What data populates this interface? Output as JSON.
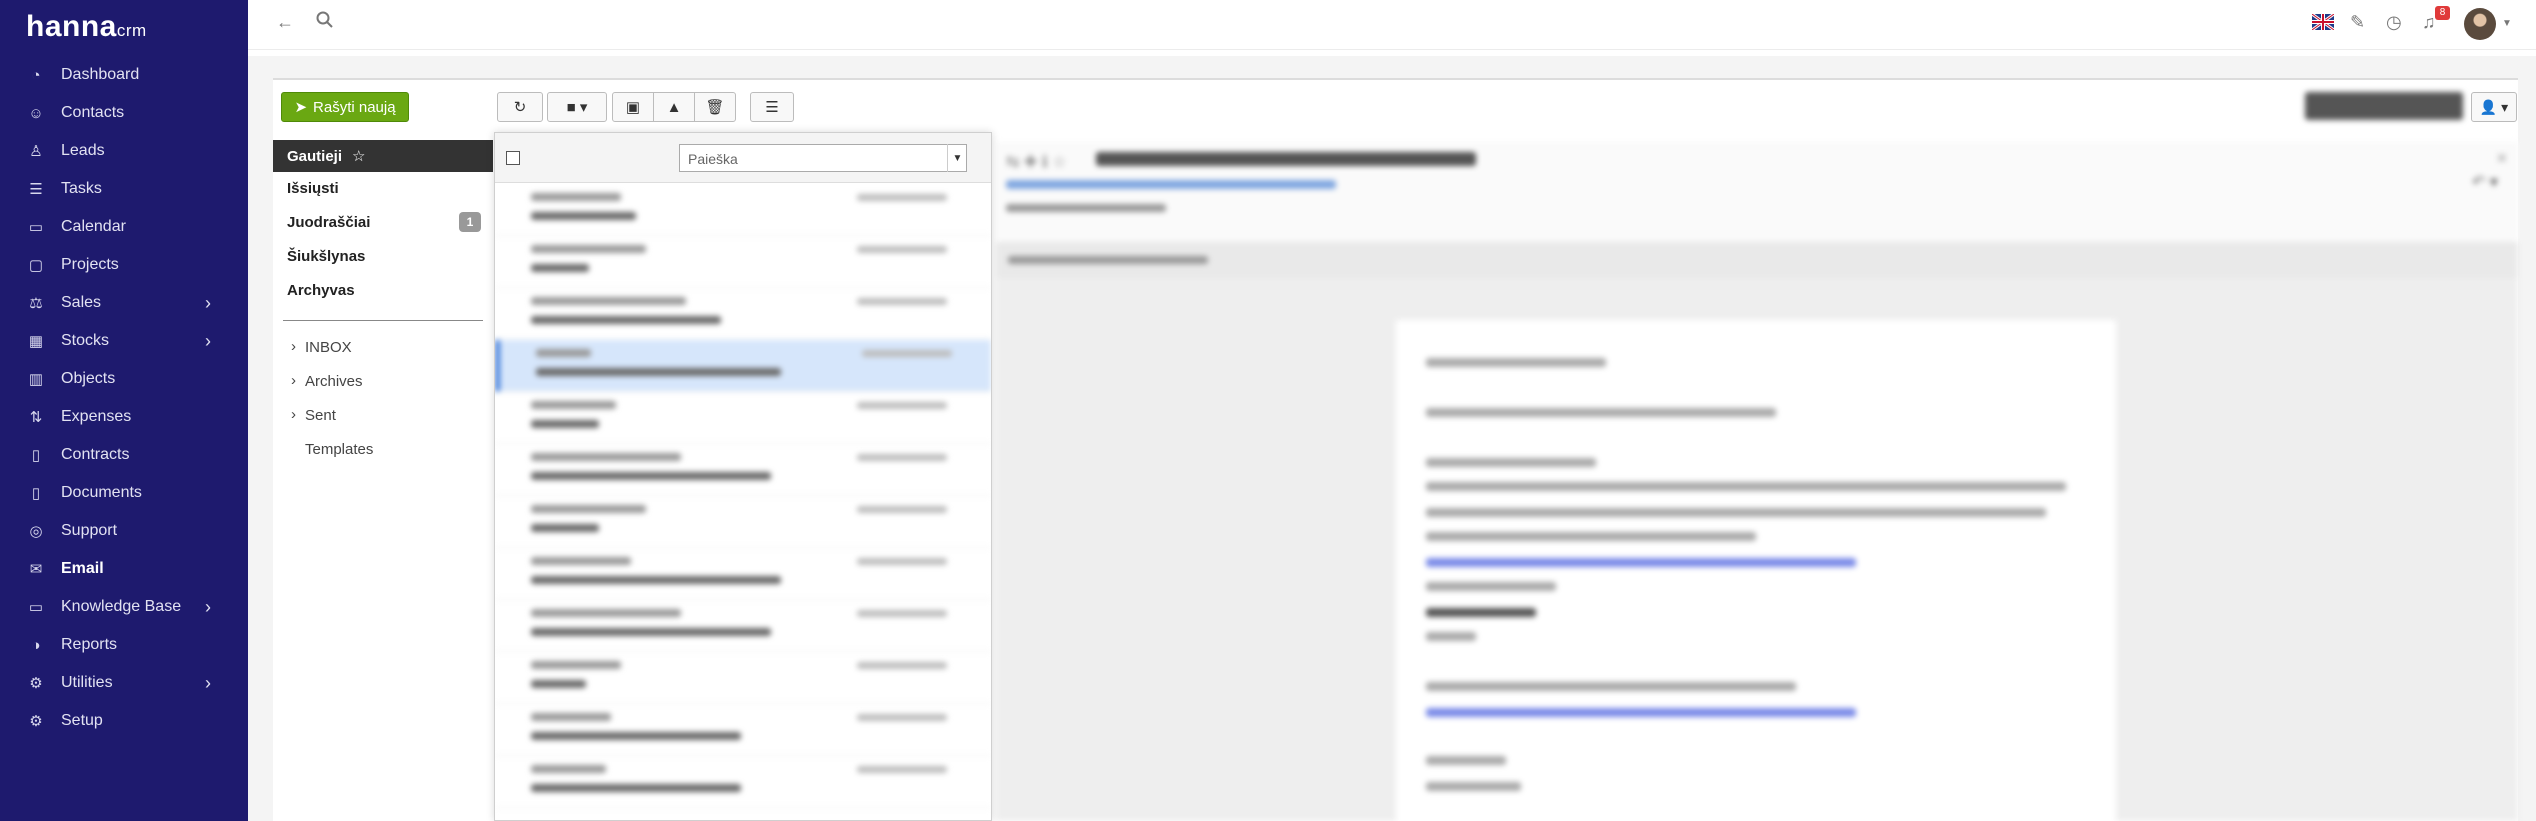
{
  "app": {
    "logo": "hanna",
    "logo_suffix": "crm"
  },
  "sidebar": {
    "items": [
      {
        "label": "Dashboard",
        "icon": "gauge-icon",
        "chevron": false
      },
      {
        "label": "Contacts",
        "icon": "users-icon",
        "chevron": false
      },
      {
        "label": "Leads",
        "icon": "lead-icon",
        "chevron": false
      },
      {
        "label": "Tasks",
        "icon": "tasks-icon",
        "chevron": false
      },
      {
        "label": "Calendar",
        "icon": "calendar-icon",
        "chevron": false
      },
      {
        "label": "Projects",
        "icon": "projects-icon",
        "chevron": false
      },
      {
        "label": "Sales",
        "icon": "sales-icon",
        "chevron": true
      },
      {
        "label": "Stocks",
        "icon": "stocks-icon",
        "chevron": true
      },
      {
        "label": "Objects",
        "icon": "objects-icon",
        "chevron": false
      },
      {
        "label": "Expenses",
        "icon": "expenses-icon",
        "chevron": false
      },
      {
        "label": "Contracts",
        "icon": "contracts-icon",
        "chevron": false
      },
      {
        "label": "Documents",
        "icon": "documents-icon",
        "chevron": false
      },
      {
        "label": "Support",
        "icon": "support-icon",
        "chevron": false
      },
      {
        "label": "Email",
        "icon": "email-icon",
        "chevron": false,
        "active": true
      },
      {
        "label": "Knowledge Base",
        "icon": "folder-icon",
        "chevron": true
      },
      {
        "label": "Reports",
        "icon": "reports-icon",
        "chevron": false
      },
      {
        "label": "Utilities",
        "icon": "utilities-icon",
        "chevron": true
      },
      {
        "label": "Setup",
        "icon": "setup-icon",
        "chevron": false
      }
    ]
  },
  "topbar": {
    "notification_count": "8"
  },
  "toolbar": {
    "compose_label": "Rašyti naują"
  },
  "folders": {
    "header": "Gautieji",
    "items": [
      {
        "label": "Išsiųsti"
      },
      {
        "label": "Juodraščiai",
        "count": "1"
      },
      {
        "label": "Šiukšlynas"
      },
      {
        "label": "Archyvas"
      }
    ],
    "imap": [
      {
        "label": "INBOX"
      },
      {
        "label": "Archives"
      },
      {
        "label": "Sent"
      },
      {
        "label": "Templates"
      }
    ]
  },
  "list": {
    "search_placeholder": "Paieška",
    "rows": 10
  }
}
